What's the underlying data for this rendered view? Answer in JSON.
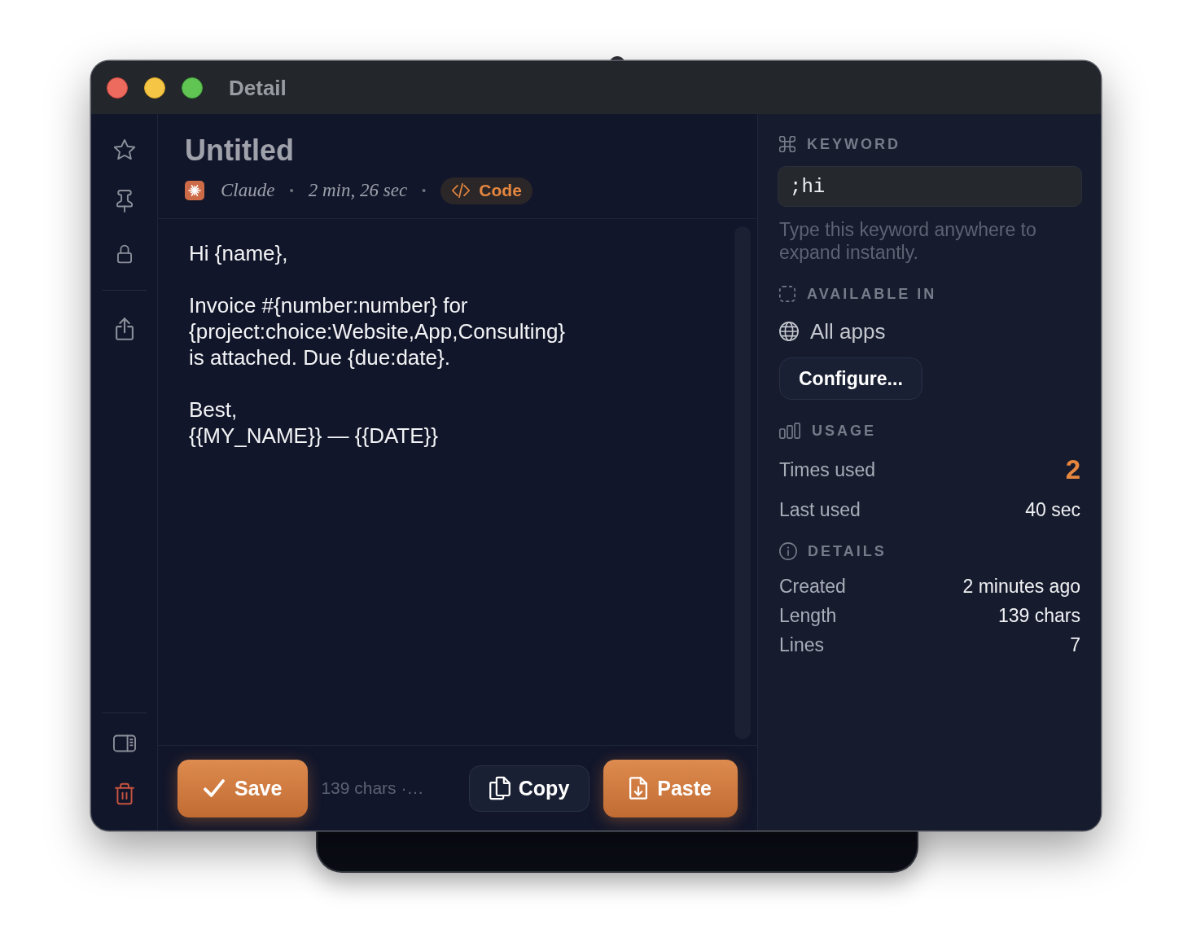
{
  "window": {
    "title": "Detail"
  },
  "snippet": {
    "title": "Untitled",
    "meta": [
      {
        "kind": "app",
        "label": "Claude"
      },
      {
        "kind": "separator",
        "label": "•"
      },
      {
        "kind": "duration",
        "label": "2 min, 26 sec"
      },
      {
        "kind": "separator",
        "label": "•"
      },
      {
        "kind": "badge",
        "label": "Code"
      }
    ],
    "body": "Hi {name},\n\nInvoice #{number:number} for\n{project:choice:Website,App,Consulting}\nis attached. Due {due:date}.\n\nBest,\n{{MY_NAME}} — {{DATE}}"
  },
  "footer": {
    "save_button": "Save",
    "status": "139 chars ·…",
    "copy_button": "Copy",
    "paste_button": "Paste"
  },
  "inspector": {
    "keyword": {
      "heading": "KEYWORD",
      "value": ";hi",
      "hint": "Type this keyword anywhere to expand instantly."
    },
    "available_in": {
      "heading": "AVAILABLE IN",
      "value": "All apps",
      "button": "Configure..."
    },
    "usage": {
      "heading": "USAGE",
      "rows": [
        {
          "label": "Times used",
          "value": "2",
          "emphasis": true
        },
        {
          "label": "Last used",
          "value": "40 sec",
          "emphasis": false
        }
      ]
    },
    "details": {
      "heading": "DETAILS",
      "rows": [
        {
          "label": "Created",
          "value": "2 minutes ago"
        },
        {
          "label": "Length",
          "value": "139 chars"
        },
        {
          "label": "Lines",
          "value": "7"
        }
      ]
    }
  }
}
